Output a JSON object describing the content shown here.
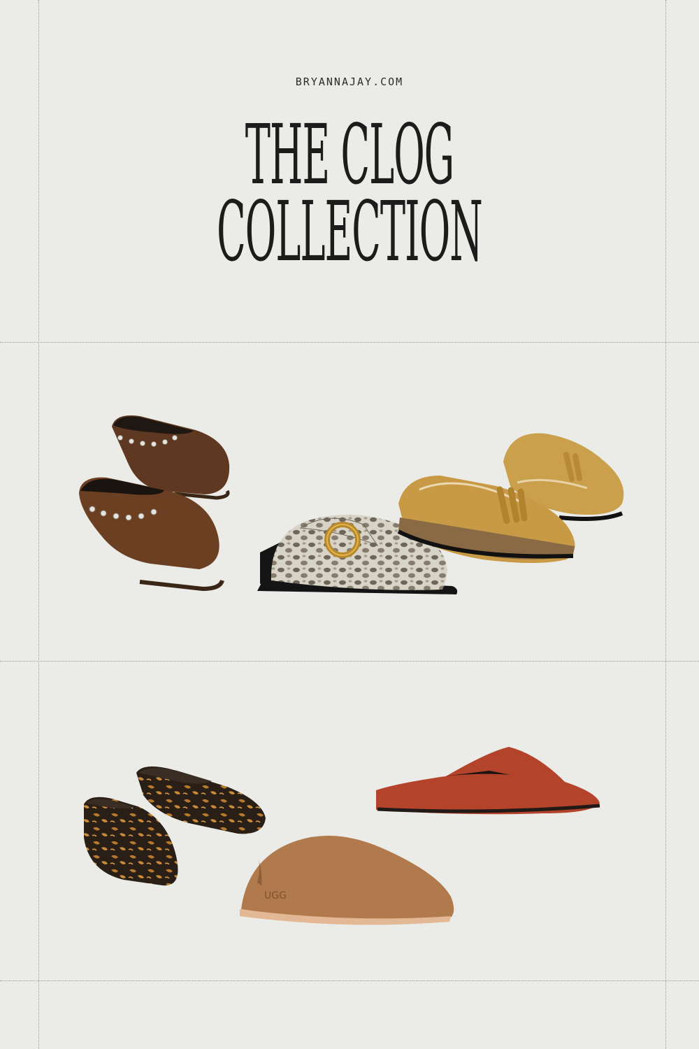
{
  "header": {
    "site": "BRYANNAJAY.COM",
    "title_line1": "THE CLOG",
    "title_line2": "COLLECTION"
  },
  "products": {
    "row1": [
      {
        "icon": "studded-suede-clog-icon",
        "color": "#6b3f22"
      },
      {
        "icon": "snakeskin-buckle-clog-icon",
        "color": "#b9b3a6"
      },
      {
        "icon": "tassel-loafer-clog-icon",
        "color": "#c99a45"
      }
    ],
    "row2": [
      {
        "icon": "leopard-calf-hair-clog-icon",
        "color": "#3a2a1c"
      },
      {
        "icon": "ugg-suede-clog-icon",
        "color": "#b07a4d",
        "brand_mark": "UGG"
      },
      {
        "icon": "red-suede-mule-icon",
        "color": "#b3442b"
      }
    ]
  }
}
